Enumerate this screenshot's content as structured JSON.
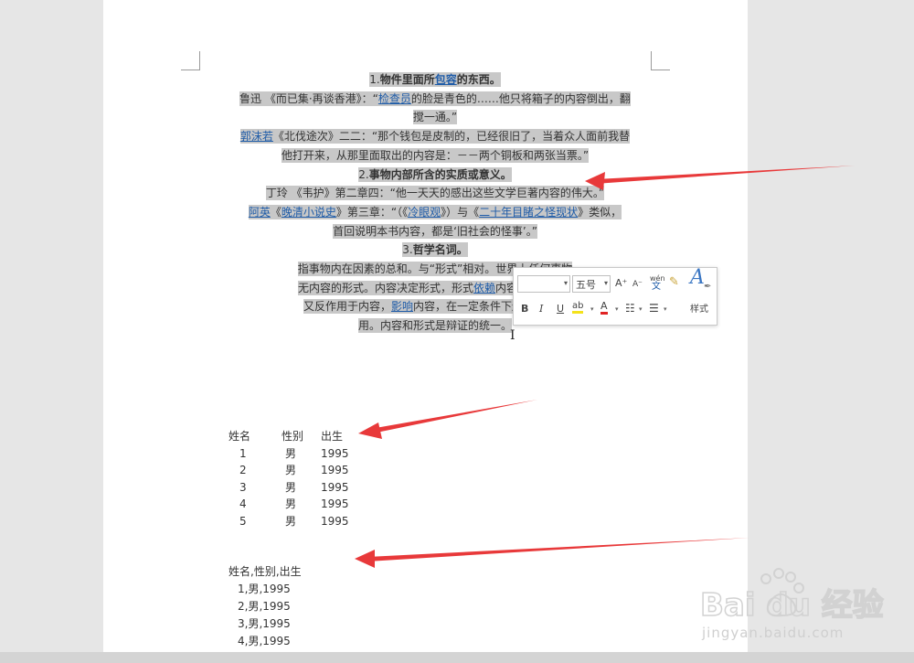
{
  "document": {
    "lines": [
      {
        "segments": [
          {
            "t": "1."
          },
          {
            "t": "物件里面所",
            "b": true
          },
          {
            "t": "包容",
            "link": true,
            "b": true
          },
          {
            "t": "的东西。",
            "b": true
          }
        ]
      },
      {
        "segments": [
          {
            "t": "鲁迅 《而已集·再谈香港》：“"
          },
          {
            "t": "检查员",
            "link": true
          },
          {
            "t": "的脸是青色的……他只将箱子的内容倒出，翻"
          }
        ]
      },
      {
        "segments": [
          {
            "t": "搅一通。”"
          }
        ]
      },
      {
        "segments": [
          {
            "t": "郭沫若",
            "link": true
          },
          {
            "t": "《北伐途次》二二：“那个钱包是皮制的，已经很旧了，当着众人面前我替"
          }
        ]
      },
      {
        "segments": [
          {
            "t": "他打开来，从那里面取出的内容是：－－两个铜板和两张当票。”"
          }
        ]
      },
      {
        "segments": [
          {
            "t": "2."
          },
          {
            "t": "事物内部所含的实质或意义。",
            "b": true
          }
        ]
      },
      {
        "segments": [
          {
            "t": "丁玲 《韦护》第二章四：“他一天天的感出这些文学巨著内容的伟大。”"
          }
        ]
      },
      {
        "segments": [
          {
            "t": "阿英",
            "link": true
          },
          {
            "t": "《"
          },
          {
            "t": "晚清小说史",
            "link": true
          },
          {
            "t": "》第三章：“（《"
          },
          {
            "t": "冷眼观",
            "link": true
          },
          {
            "t": "》）与《"
          },
          {
            "t": "二十年目睹之怪现状",
            "link": true
          },
          {
            "t": "》类似，"
          }
        ]
      },
      {
        "segments": [
          {
            "t": "首回说明本书内容，都是‘旧社会的怪事’。”"
          }
        ]
      },
      {
        "segments": [
          {
            "t": "3."
          },
          {
            "t": "哲学名词。",
            "b": true
          }
        ]
      },
      {
        "segments": [
          {
            "t": "指事物内在因素的总和。与“形式”相对。世界上任何事物"
          }
        ]
      },
      {
        "segments": [
          {
            "t": "无内容的形式。内容决定形式，形式"
          },
          {
            "t": "依赖",
            "link": true
          },
          {
            "t": "内容，并随着内"
          }
        ]
      },
      {
        "segments": [
          {
            "t": "又反作用于内容，"
          },
          {
            "t": "影响",
            "link": true
          },
          {
            "t": "内容，在一定条件下还可以对内"
          }
        ]
      },
      {
        "segments": [
          {
            "t": "用。内容和形式是辩证的统一。"
          }
        ]
      }
    ]
  },
  "minibar": {
    "font_name": "",
    "font_size": "五号",
    "grow_icon": "A⁺",
    "shrink_icon": "A⁻",
    "pinyin_top": "wén",
    "pinyin_bottom": "文",
    "bold": "B",
    "italic": "I",
    "underline": "U",
    "highlight": "ab",
    "font_color": "A",
    "bullets": "☷",
    "numbering": "☰",
    "styles_label": "样式"
  },
  "table": {
    "headers": [
      "姓名",
      "性别",
      "出生"
    ],
    "rows": [
      [
        "1",
        "男",
        "1995"
      ],
      [
        "2",
        "男",
        "1995"
      ],
      [
        "3",
        "男",
        "1995"
      ],
      [
        "4",
        "男",
        "1995"
      ],
      [
        "5",
        "男",
        "1995"
      ]
    ]
  },
  "csv": {
    "lines": [
      "姓名,性别,出生",
      "1,男,1995",
      "2,男,1995",
      "3,男,1995",
      "4,男,1995"
    ]
  },
  "watermark": {
    "brand": "Bai du 经验",
    "url": "jingyan.baidu.com"
  },
  "colors": {
    "arrow": "#e8393a",
    "highlight": "#c8c8c8",
    "link": "#1f5ca8"
  }
}
